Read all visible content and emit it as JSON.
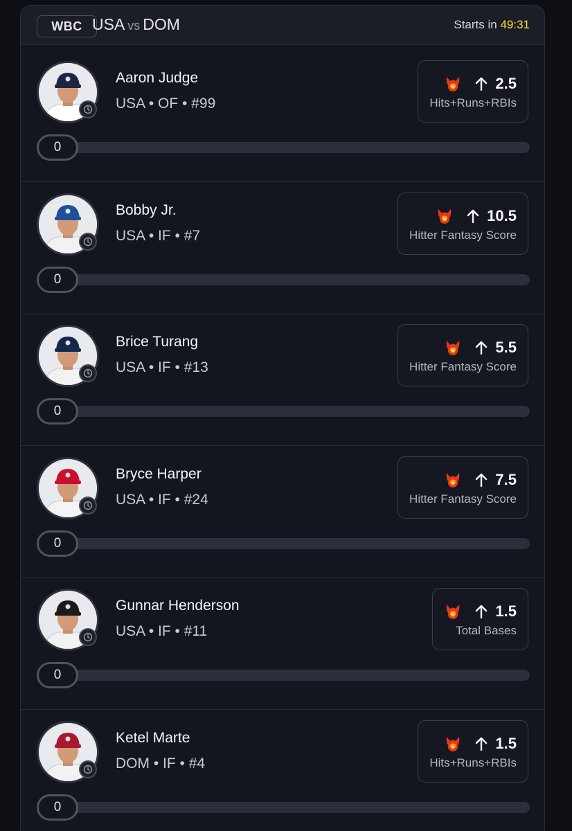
{
  "header": {
    "league": "WBC",
    "team_home": "USA",
    "vs": "vs",
    "team_away": "DOM",
    "starts_label": "Starts in",
    "countdown": "49:31"
  },
  "colors": {
    "countdown": "#f3e33a",
    "fire": "#e8361e",
    "background": "#14161f"
  },
  "players": [
    {
      "name": "Aaron Judge",
      "meta": "USA • OF • #99",
      "line": "2.5",
      "stat": "Hits+Runs+RBIs",
      "progress": "0",
      "progress_fraction": 0,
      "direction_icon": "arrow-up-icon",
      "cap_color": "#1c2541",
      "jersey_color": "#ffffff"
    },
    {
      "name": "Bobby Jr.",
      "meta": "USA • IF • #7",
      "line": "10.5",
      "stat": "Hitter Fantasy Score",
      "progress": "0",
      "progress_fraction": 0,
      "direction_icon": "arrow-up-icon",
      "cap_color": "#1f4f9b",
      "jersey_color": "#f2f2f2"
    },
    {
      "name": "Brice Turang",
      "meta": "USA • IF • #13",
      "line": "5.5",
      "stat": "Hitter Fantasy Score",
      "progress": "0",
      "progress_fraction": 0,
      "direction_icon": "arrow-up-icon",
      "cap_color": "#13294b",
      "jersey_color": "#f2f2f2"
    },
    {
      "name": "Bryce Harper",
      "meta": "USA • IF • #24",
      "line": "7.5",
      "stat": "Hitter Fantasy Score",
      "progress": "0",
      "progress_fraction": 0,
      "direction_icon": "arrow-up-icon",
      "cap_color": "#c8102e",
      "jersey_color": "#f4f4f4"
    },
    {
      "name": "Gunnar Henderson",
      "meta": "USA • IF • #11",
      "line": "1.5",
      "stat": "Total Bases",
      "progress": "0",
      "progress_fraction": 0,
      "direction_icon": "arrow-up-icon",
      "cap_color": "#1a1a1a",
      "jersey_color": "#f2f2f2"
    },
    {
      "name": "Ketel Marte",
      "meta": "DOM • IF • #4",
      "line": "1.5",
      "stat": "Hits+Runs+RBIs",
      "progress": "0",
      "progress_fraction": 0,
      "direction_icon": "arrow-up-icon",
      "cap_color": "#a71930",
      "jersey_color": "#f2f2f2"
    }
  ]
}
